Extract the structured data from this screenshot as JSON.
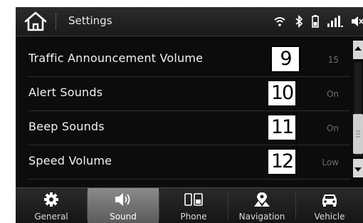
{
  "header": {
    "title": "Settings"
  },
  "list": [
    {
      "label": "Traffic Announcement Volume",
      "callout": "9",
      "value": "15"
    },
    {
      "label": "Alert Sounds",
      "callout": "10",
      "value": "On"
    },
    {
      "label": "Beep Sounds",
      "callout": "11",
      "value": "On"
    },
    {
      "label": "Speed Volume",
      "callout": "12",
      "value": "Low"
    }
  ],
  "tabs": [
    {
      "label": "General",
      "icon": "gear-icon"
    },
    {
      "label": "Sound",
      "icon": "speaker-icon",
      "active": true
    },
    {
      "label": "Phone",
      "icon": "phone-icon"
    },
    {
      "label": "Navigation",
      "icon": "navigation-icon"
    },
    {
      "label": "Vehicle",
      "icon": "car-icon"
    }
  ],
  "status_icons": [
    "wifi-icon",
    "bluetooth-icon",
    "battery-icon",
    "signal-icon",
    "mute-icon"
  ]
}
